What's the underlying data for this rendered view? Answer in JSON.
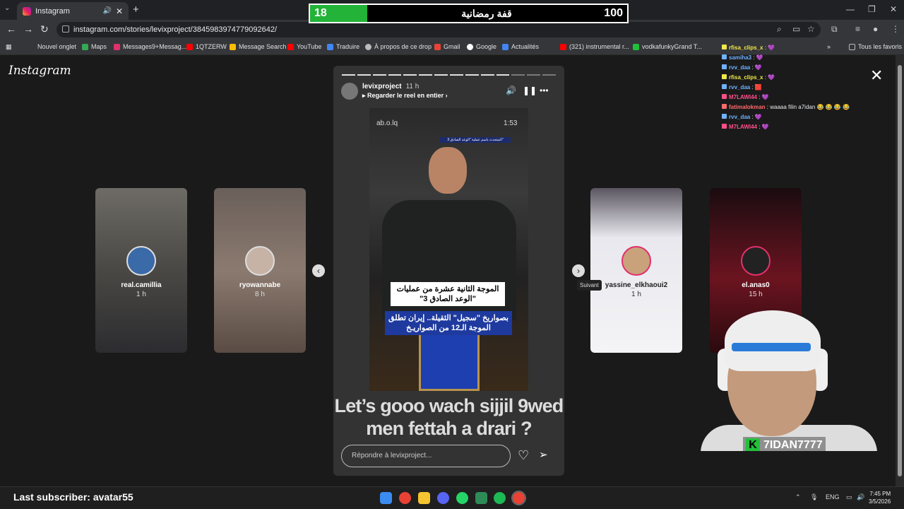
{
  "browser": {
    "tab_title": "Instagram",
    "url": "instagram.com/stories/levixproject/3845983974779092642/",
    "bookmarks": [
      "Nouvel onglet",
      "Maps",
      "Messages9+Messag...",
      "1QTZERW",
      "Message Search",
      "YouTube",
      "Traduire",
      "À propos de ce drop",
      "Gmail",
      "Google",
      "Actualités",
      "(321) instrumental r...",
      "vodkafunkyGrand T...",
      "Tous les favoris"
    ]
  },
  "scoreboard": {
    "left_value": "18",
    "title": "قفة رمضانية",
    "right_value": "100",
    "fill_fraction": 0.18,
    "fill_color": "#22b338"
  },
  "instagram": {
    "logo": "Instagram",
    "side_stories": [
      {
        "name": "real.camillia",
        "time": "1 h"
      },
      {
        "name": "ryowannabe",
        "time": "8 h"
      },
      {
        "name": "yassine_elkhaoui2",
        "time": "1 h"
      },
      {
        "name": "el.anas0",
        "time": "15 h"
      }
    ],
    "next_tooltip": "Suivant",
    "story": {
      "username": "levixproject",
      "time": "11 h",
      "reel_link": "Regarder le reel en entier",
      "video_handle": "ab.o.lq",
      "video_time": "1:53",
      "chyron": "المتحدث باسم عملية \"الوعد الصادق 3\"",
      "caption_white": "الموجة الثانية عشرة من عمليات \"الوعد الصادق 3\"",
      "caption_blue": "بصواريخ \"سجيل\" الثقيلة.. إيران تطلق الموجة الـ12 من الصواريـخ",
      "overlay_line1": "Let’s gooo wach sijjil 9wed",
      "overlay_line2": "men fettah a drari ?",
      "reply_placeholder": "Répondre à levixproject..."
    }
  },
  "stream": {
    "chat": [
      {
        "user": "rfisa_clips_x",
        "msg": "💜",
        "color": "#f0e84a"
      },
      {
        "user": "samiha3",
        "msg": "💜",
        "color": "#6fb2ff"
      },
      {
        "user": "rvv_daa",
        "msg": "💜",
        "color": "#6fb2ff"
      },
      {
        "user": "rfisa_clips_x",
        "msg": "💜",
        "color": "#f0e84a"
      },
      {
        "user": "rvv_daa",
        "msg": "🟥",
        "color": "#6fb2ff"
      },
      {
        "user": "M7LAWI44",
        "msg": "💜",
        "color": "#ff4f8a"
      },
      {
        "user": "fatimalokman",
        "msg": "waaaa filin a7idan 😂 😂 😂 😂",
        "color": "#ff6b6b"
      },
      {
        "user": "rvv_daa",
        "msg": "💜",
        "color": "#6fb2ff"
      },
      {
        "user": "M7LAWI44",
        "msg": "💜",
        "color": "#ff4f8a"
      }
    ],
    "webcam_name": "7IDAN7777",
    "last_subscriber": "Last subscriber: avatar55"
  },
  "taskbar": {
    "lang": "ENG",
    "time": "7:45 PM",
    "date": "3/5/2026"
  }
}
